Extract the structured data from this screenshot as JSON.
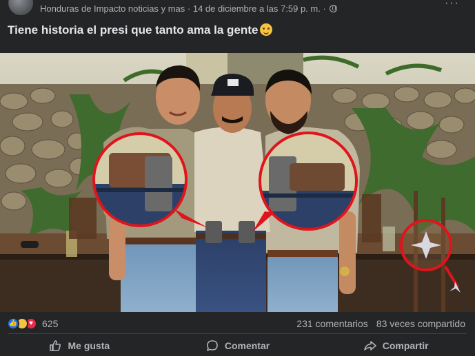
{
  "post": {
    "page_name": "Honduras de Impacto noticias y mas",
    "separator": " · ",
    "timestamp": "14 de diciembre a las 7:59 p. m.",
    "separator2": " · ",
    "privacy_icon": "globe-icon",
    "more_icon": "ellipsis-icon",
    "more_label": "···",
    "caption": "Tiene historia el presi que tanto ama la gente"
  },
  "reactions": {
    "icons": [
      "like-icon",
      "haha-icon",
      "love-icon"
    ],
    "count": "625"
  },
  "stats": {
    "comments": "231 comentarios",
    "shares": "83 veces compartido"
  },
  "actions": {
    "like": "Me gusta",
    "comment": "Comentar",
    "share": "Compartir"
  },
  "colors": {
    "background": "#242526",
    "text_primary": "#e4e6eb",
    "text_secondary": "#b0b3b8",
    "highlight_circle": "#e0141b",
    "like_blue": "#1877f2"
  }
}
